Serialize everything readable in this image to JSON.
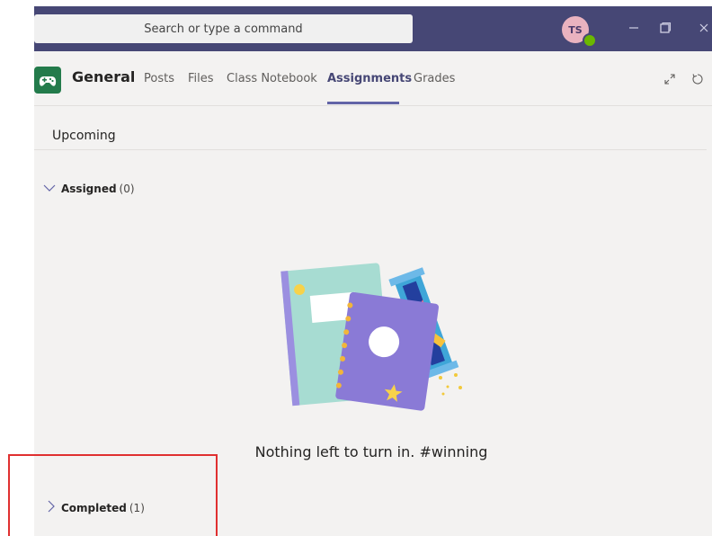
{
  "titlebar": {
    "search_placeholder": "Search or type a command",
    "avatar_initials": "TS",
    "accent": "#464775"
  },
  "header": {
    "channel_name": "General",
    "tabs": [
      {
        "label": "Posts"
      },
      {
        "label": "Files"
      },
      {
        "label": "Class Notebook"
      },
      {
        "label": "Assignments",
        "active": true
      },
      {
        "label": "Grades"
      }
    ]
  },
  "main": {
    "section_title": "Upcoming",
    "assigned": {
      "label": "Assigned",
      "count": "(0)"
    },
    "empty_message": "Nothing left to turn in. #winning",
    "completed": {
      "label": "Completed",
      "count": "(1)"
    }
  },
  "icons": [
    "search-icon",
    "minimize-icon",
    "restore-icon",
    "close-icon",
    "expand-icon",
    "refresh-icon",
    "chevron-down-icon",
    "chevron-right-icon"
  ],
  "colors": {
    "highlight_box": "#e03030",
    "tab_accent": "#6264a7",
    "team_icon": "#237b4b"
  }
}
